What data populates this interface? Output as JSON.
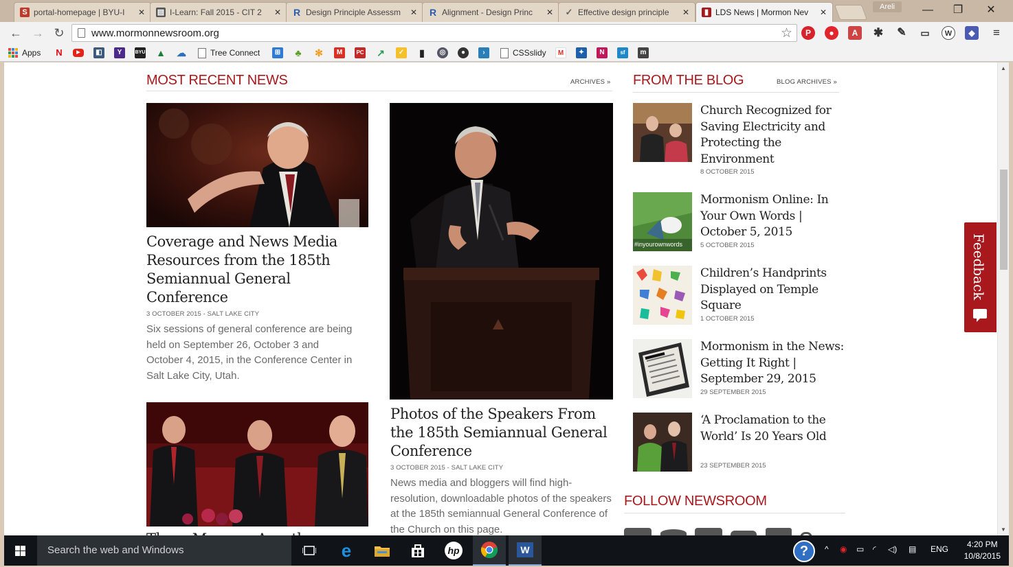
{
  "browser": {
    "tabs": [
      {
        "label": "portal-homepage | BYU-I",
        "fav_color": "#c0392b",
        "fav_char": "S"
      },
      {
        "label": "I-Learn: Fall 2015 - CIT 2",
        "fav_color": "#555555",
        "fav_char": "▤"
      },
      {
        "label": "Design Principle Assessm",
        "fav_color": "#2a5db0",
        "fav_char": "R"
      },
      {
        "label": "Alignment - Design Princ",
        "fav_color": "#2a5db0",
        "fav_char": "R"
      },
      {
        "label": "Effective design principle",
        "fav_color": "#666666",
        "fav_char": "✓"
      },
      {
        "label": "LDS News | Mormon Nev",
        "fav_color": "#a8181c",
        "fav_char": "▮"
      }
    ],
    "profile_name": "Areli",
    "url": "www.mormonnewsroom.org",
    "bookmarks": {
      "apps_label": "Apps",
      "tree_connect_label": "Tree Connect",
      "cssslidy_label": "CSSslidy"
    }
  },
  "page": {
    "most_recent": {
      "heading": "MOST RECENT NEWS",
      "archives_link": "ARCHIVES »",
      "articles": [
        {
          "title": "Coverage and News Media Resources from the 185th Semiannual General Conference",
          "meta": "3 OCTOBER 2015 - SALT LAKE CITY",
          "summary": "Six sessions of general conference are being held on September 26, October 3 and October 4, 2015, in the Conference Center in Salt Lake City, Utah."
        },
        {
          "title": "Photos of the Speakers From the 185th Semiannual General Conference",
          "meta": "3 OCTOBER 2015 - SALT LAKE CITY",
          "summary": "News media and bloggers will find high-resolution, downloadable photos of the speakers at the 185th semiannual General Conference of the Church on this page."
        },
        {
          "title": "Three Mormon Apostles"
        }
      ]
    },
    "blog": {
      "heading": "FROM THE BLOG",
      "archives_link": "BLOG ARCHIVES »",
      "items": [
        {
          "title": "Church Recognized for Saving Electricity and Protecting the Environment",
          "date": "8 OCTOBER 2015"
        },
        {
          "title": "Mormonism Online: In Your Own Words | October 5, 2015",
          "date": "5 OCTOBER 2015",
          "thumb_text": "#inyourownwords"
        },
        {
          "title": "Children’s Handprints Displayed on Temple Square",
          "date": "1 OCTOBER 2015"
        },
        {
          "title": "Mormonism in the News: Getting It Right | September 29, 2015",
          "date": "29 SEPTEMBER 2015"
        },
        {
          "title": "‘A Proclamation to the World’ Is 20 Years Old",
          "date": "23 SEPTEMBER 2015"
        }
      ]
    },
    "follow_heading": "FOLLOW NEWSROOM",
    "feedback_label": "Feedback"
  },
  "taskbar": {
    "search_placeholder": "Search the web and Windows",
    "language": "ENG",
    "time": "4:20 PM",
    "date": "10/8/2015"
  },
  "colors": {
    "brand_red": "#a8181c",
    "taskbar": "#101418"
  }
}
